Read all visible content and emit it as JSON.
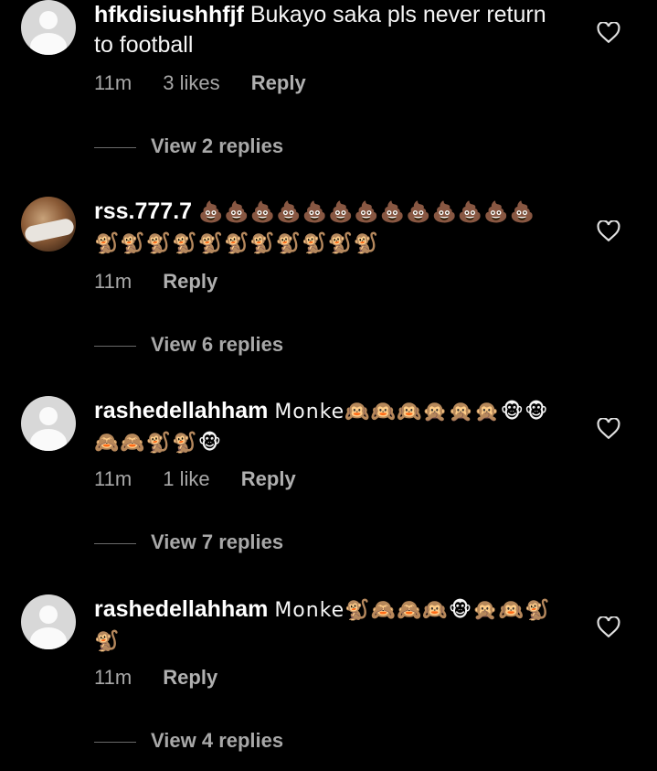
{
  "comments": [
    {
      "username": "hfkdisiushhfjf",
      "text": "Bukayo saka pls never return to football",
      "time": "11m",
      "likes": "3 likes",
      "reply_label": "Reply",
      "view_replies": "View 2 replies"
    },
    {
      "username": "rss.777.7",
      "text": "💩💩💩💩💩💩💩💩💩💩💩💩💩🐒🐒🐒🐒🐒🐒🐒🐒🐒🐒🐒",
      "time": "11m",
      "reply_label": "Reply",
      "view_replies": "View 6 replies"
    },
    {
      "username": "rashedellahham",
      "text": "Monke🙉🙉🙉🙊🙊🙊🐵🐵🙈🙈🐒🐒🐵",
      "time": "11m",
      "likes": "1 like",
      "reply_label": "Reply",
      "view_replies": "View 7 replies"
    },
    {
      "username": "rashedellahham",
      "text": "Monke🐒🙈🙈🙉🐵🙊🙉🐒🐒",
      "time": "11m",
      "reply_label": "Reply",
      "view_replies": "View 4 replies"
    }
  ],
  "icons": {
    "like": "heart-outline-icon",
    "avatar_default": "default-avatar-icon"
  },
  "colors": {
    "background": "#000000",
    "primary_text": "#f5f5f5",
    "secondary_text": "#a8a8a8"
  }
}
